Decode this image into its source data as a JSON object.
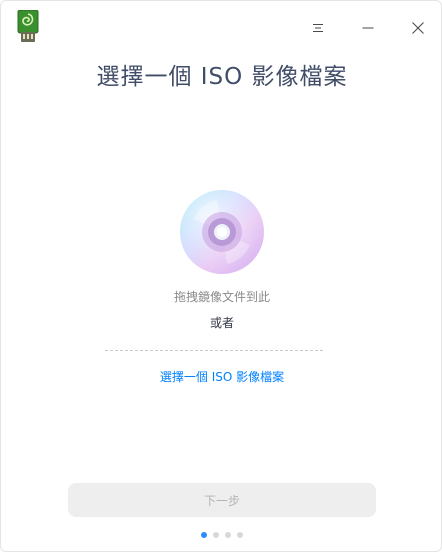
{
  "window": {
    "title": "選擇一個 ISO 影像檔案"
  },
  "titlebar": {
    "logo_icon": "usb-drive-icon",
    "menu_icon": "menu-icon",
    "minimize_icon": "minimize-icon",
    "close_icon": "close-icon"
  },
  "main": {
    "disc_icon": "disc-icon",
    "drop_hint": "拖拽鏡像文件到此",
    "or_text": "或者",
    "select_link": "選擇一個 ISO 影像檔案"
  },
  "footer": {
    "next_label": "下一步",
    "pager": {
      "total": 4,
      "current": 1
    }
  },
  "colors": {
    "accent": "#0081ff",
    "title": "#414d68",
    "disabled_button_bg": "#eeeeee",
    "disabled_button_text": "#b4b4b4",
    "active_dot": "#2c8cff"
  }
}
